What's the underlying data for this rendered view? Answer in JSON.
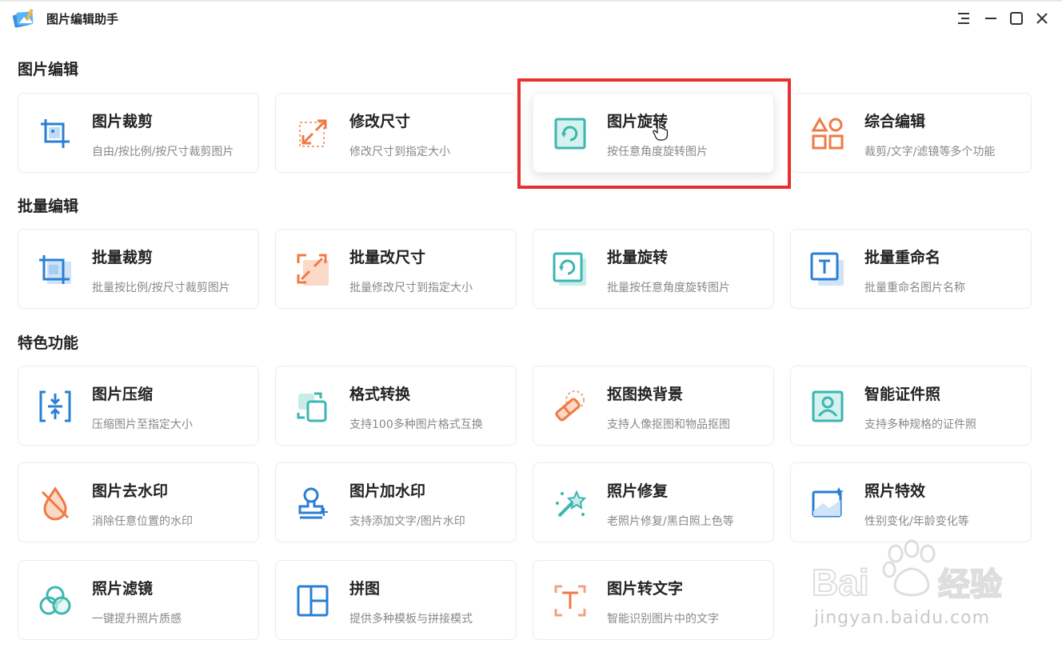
{
  "app": {
    "title": "图片编辑助手"
  },
  "sections": {
    "image_edit": {
      "title": "图片编辑",
      "cards": [
        {
          "title": "图片裁剪",
          "desc": "自由/按比例/按尺寸裁剪图片"
        },
        {
          "title": "修改尺寸",
          "desc": "修改尺寸到指定大小"
        },
        {
          "title": "图片旋转",
          "desc": "按任意角度旋转图片"
        },
        {
          "title": "综合编辑",
          "desc": "裁剪/文字/滤镜等多个功能"
        }
      ]
    },
    "batch_edit": {
      "title": "批量编辑",
      "cards": [
        {
          "title": "批量裁剪",
          "desc": "批量按比例/按尺寸裁剪图片"
        },
        {
          "title": "批量改尺寸",
          "desc": "批量修改尺寸到指定大小"
        },
        {
          "title": "批量旋转",
          "desc": "批量按任意角度旋转图片"
        },
        {
          "title": "批量重命名",
          "desc": "批量重命名图片名称"
        }
      ]
    },
    "features": {
      "title": "特色功能",
      "cards": [
        {
          "title": "图片压缩",
          "desc": "压缩图片至指定大小"
        },
        {
          "title": "格式转换",
          "desc": "支持100多种图片格式互换"
        },
        {
          "title": "抠图换背景",
          "desc": "支持人像抠图和物品抠图"
        },
        {
          "title": "智能证件照",
          "desc": "支持多种规格的证件照"
        },
        {
          "title": "图片去水印",
          "desc": "消除任意位置的水印"
        },
        {
          "title": "图片加水印",
          "desc": "支持添加文字/图片水印"
        },
        {
          "title": "照片修复",
          "desc": "老照片修复/黑白照上色等"
        },
        {
          "title": "照片特效",
          "desc": "性别变化/年龄变化等"
        },
        {
          "title": "照片滤镜",
          "desc": "一键提升照片质感"
        },
        {
          "title": "拼图",
          "desc": "提供多种模板与拼接模式"
        },
        {
          "title": "图片转文字",
          "desc": "智能识别图片中的文字"
        }
      ]
    }
  },
  "overlay": {
    "watermark_text": "jingyan.baidu.com"
  },
  "colors": {
    "highlight": "#e83030",
    "blue": "#2a7fd4",
    "teal": "#3cb6b0",
    "orange": "#ef7a45"
  }
}
